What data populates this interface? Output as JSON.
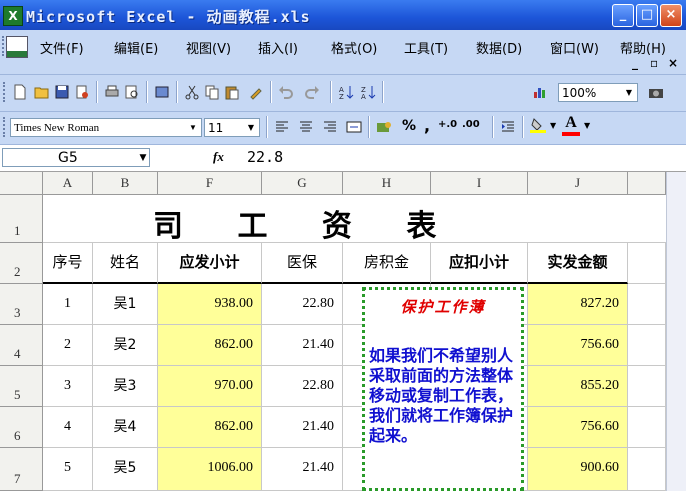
{
  "window": {
    "title": "Microsoft Excel - 动画教程.xls",
    "app_icon": "X"
  },
  "menu": {
    "items": [
      "文件(F)",
      "编辑(E)",
      "视图(V)",
      "插入(I)",
      "格式(O)",
      "工具(T)",
      "数据(D)",
      "窗口(W)",
      "帮助(H)"
    ],
    "mdi_controls": [
      "_",
      "▫",
      "×"
    ]
  },
  "toolbar": {
    "zoom": "100%"
  },
  "format_toolbar": {
    "font": "Times New Roman",
    "size": "11",
    "percent": "%",
    "comma": ",",
    "inc_dec": "+.0",
    "dec_dec": ".00"
  },
  "formula_bar": {
    "cell_ref": "G5",
    "fx": "fx",
    "value": "22.8"
  },
  "columns": [
    "A",
    "B",
    "F",
    "G",
    "H",
    "I",
    "J"
  ],
  "rows": [
    "1",
    "2",
    "3",
    "4",
    "5",
    "6",
    "7"
  ],
  "sheet": {
    "title": "司 工 资 表",
    "headers": {
      "a": "序号",
      "b": "姓名",
      "f": "应发小计",
      "g": "医保",
      "h": "房积金",
      "i": "应扣小计",
      "j": "实发金额"
    },
    "data": [
      {
        "seq": "1",
        "name": "吴1",
        "f": "938.00",
        "g": "22.80",
        "j": "827.20"
      },
      {
        "seq": "2",
        "name": "吴2",
        "f": "862.00",
        "g": "21.40",
        "j": "756.60"
      },
      {
        "seq": "3",
        "name": "吴3",
        "f": "970.00",
        "g": "22.80",
        "j": "855.20"
      },
      {
        "seq": "4",
        "name": "吴4",
        "f": "862.00",
        "g": "21.40",
        "j": "756.60"
      },
      {
        "seq": "5",
        "name": "吴5",
        "f": "1006.00",
        "g": "21.40",
        "j": "900.60"
      }
    ]
  },
  "comment": {
    "title": "保护工作薄",
    "body": "如果我们不希望别人采取前面的方法整体移动或复制工作表，我们就将工作簿保护起来。"
  },
  "colors": {
    "title_bar": "#1c55d8",
    "toolbar": "#c6d8f4",
    "highlight": "#ffff99",
    "comment_border": "#2a9a2a",
    "comment_title": "#e00000",
    "comment_body": "#1010d0"
  }
}
